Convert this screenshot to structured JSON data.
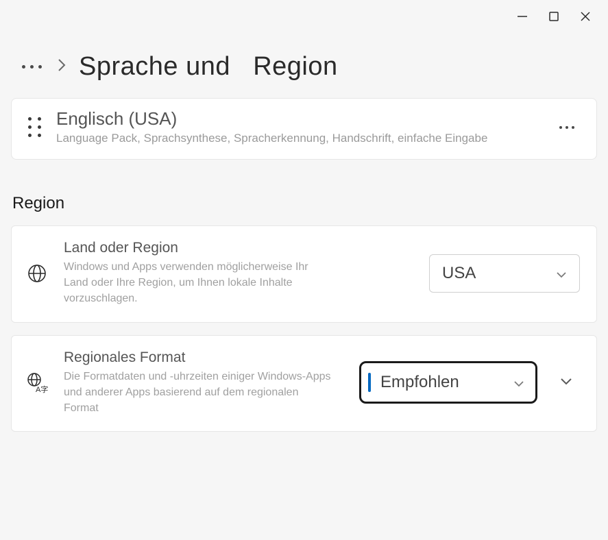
{
  "breadcrumb": {
    "title_part1": "Sprache und",
    "title_part2": "Region"
  },
  "language_item": {
    "title": "Englisch (USA)",
    "description": "Language Pack, Sprachsynthese, Spracherkennung, Handschrift, einfache Eingabe"
  },
  "section": {
    "region_header": "Region"
  },
  "region_setting": {
    "title": "Land oder Region",
    "description": "Windows und Apps verwenden möglicherweise Ihr Land oder Ihre Region, um Ihnen lokale Inhalte vorzuschlagen.",
    "value": "USA"
  },
  "format_setting": {
    "title": "Regionales Format",
    "description": "Die Formatdaten und -uhrzeiten einiger Windows-Apps und anderer Apps basierend auf dem regionalen Format",
    "value": "Empfohlen"
  }
}
